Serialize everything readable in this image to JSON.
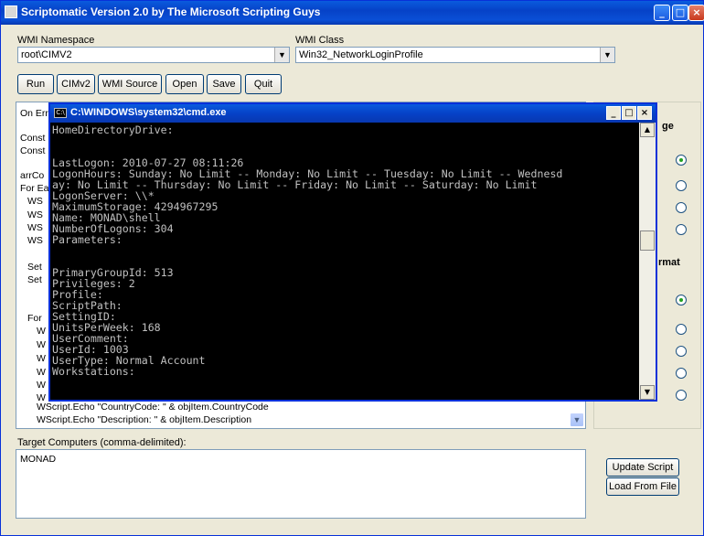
{
  "window": {
    "title": "Scriptomatic Version 2.0 by The Microsoft Scripting Guys"
  },
  "namespace": {
    "label": "WMI Namespace",
    "value": "root\\CIMV2"
  },
  "wmiclass": {
    "label": "WMI Class",
    "value": "Win32_NetworkLoginProfile"
  },
  "toolbar": {
    "run": "Run",
    "cimv2": "CIMv2",
    "wmi_source": "WMI Source",
    "open": "Open",
    "save": "Save",
    "quit": "Quit"
  },
  "editor": {
    "lines": [
      "On Err",
      "Const",
      "Const",
      "arrCo",
      "For Ea",
      "WS",
      "WS",
      "WS",
      "WS",
      "Set",
      "Set",
      "For",
      "W",
      "W",
      "W",
      "W",
      "W",
      "W",
      "WScript.Echo \"CountryCode: \" & objItem.CountryCode",
      "WScript.Echo \"Description: \" & objItem.Description"
    ]
  },
  "options": {
    "heading_fragment1": "ge",
    "heading_fragment2": "rmat"
  },
  "targets": {
    "label": "Target Computers (comma-delimited):",
    "value": "MONAD"
  },
  "side_buttons": {
    "update": "Update Script",
    "load": "Load From File"
  },
  "cmd": {
    "title": "C:\\WINDOWS\\system32\\cmd.exe",
    "lines": [
      "HomeDirectoryDrive:",
      "",
      "",
      "LastLogon: 2010-07-27 08:11:26",
      "LogonHours: Sunday: No Limit -- Monday: No Limit -- Tuesday: No Limit -- Wednesd",
      "ay: No Limit -- Thursday: No Limit -- Friday: No Limit -- Saturday: No Limit",
      "LogonServer: \\\\*",
      "MaximumStorage: 4294967295",
      "Name: MONAD\\shell",
      "NumberOfLogons: 304",
      "Parameters:",
      "",
      "",
      "PrimaryGroupId: 513",
      "Privileges: 2",
      "Profile:",
      "ScriptPath:",
      "SettingID:",
      "UnitsPerWeek: 168",
      "UserComment:",
      "UserId: 1003",
      "UserType: Normal Account",
      "Workstations:"
    ]
  }
}
